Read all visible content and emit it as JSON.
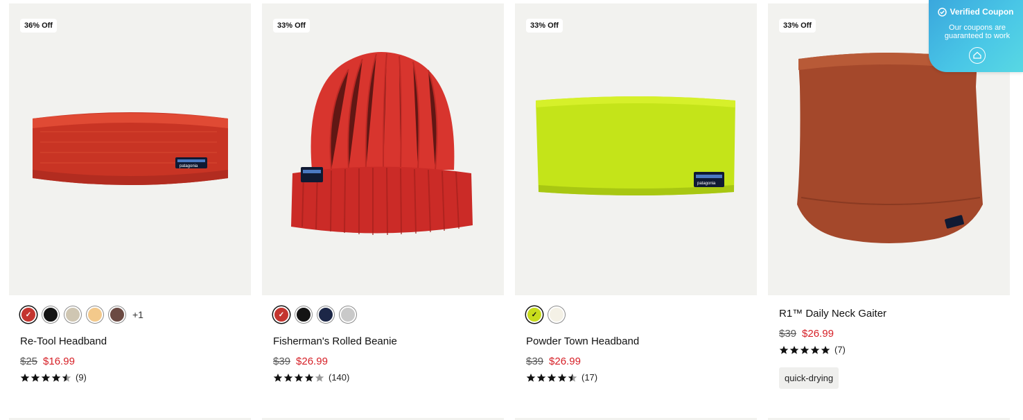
{
  "coupon": {
    "title": "Verified Coupon",
    "subtitle": "Our coupons are guaranteed to work",
    "icon": "check-circle-icon",
    "logo_icon": "home-logo-icon"
  },
  "products": [
    {
      "badge": "36% Off",
      "image_icon": "red-headband-image",
      "swatches": [
        "#c4352f",
        "#141414",
        "#cfc6b2",
        "#f3c98b",
        "#6b4a43"
      ],
      "selected_swatch": 0,
      "more_colors": "+1",
      "name": "Re-Tool Headband",
      "old_price": "$25",
      "new_price": "$16.99",
      "rating": 4.5,
      "reviews": "(9)"
    },
    {
      "badge": "33% Off",
      "image_icon": "red-beanie-image",
      "swatches": [
        "#c4352f",
        "#141414",
        "#1c2747",
        "#c9c9c9"
      ],
      "selected_swatch": 0,
      "more_colors": "",
      "name": "Fisherman's Rolled Beanie",
      "old_price": "$39",
      "new_price": "$26.99",
      "rating": 4,
      "reviews": "(140)"
    },
    {
      "badge": "33% Off",
      "image_icon": "lime-headband-image",
      "swatches": [
        "#c8dc1c",
        "#f4f1e6"
      ],
      "selected_swatch": 0,
      "more_colors": "",
      "name": "Powder Town Headband",
      "old_price": "$39",
      "new_price": "$26.99",
      "rating": 4.5,
      "reviews": "(17)"
    },
    {
      "badge": "33% Off",
      "image_icon": "rust-neck-gaiter-image",
      "swatches": [],
      "selected_swatch": -1,
      "more_colors": "",
      "name": "R1™ Daily Neck Gaiter",
      "old_price": "$39",
      "new_price": "$26.99",
      "rating": 5,
      "reviews": "(7)",
      "tag": "quick-drying"
    }
  ],
  "colors": {
    "sale_red": "#d61f26",
    "card_bg": "#f2f2ef",
    "headband_red": "#d53a28",
    "beanie_red": "#cf2d2b",
    "lime": "#c6e61c",
    "rust": "#a44a2c"
  }
}
